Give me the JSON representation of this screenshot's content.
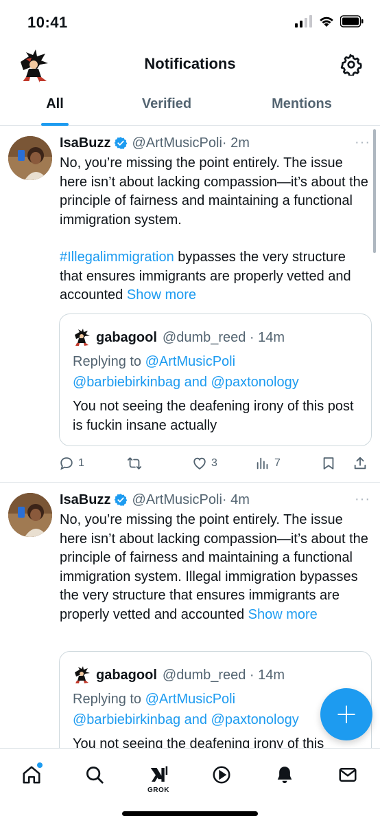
{
  "status_bar": {
    "time": "10:41"
  },
  "header": {
    "title": "Notifications"
  },
  "tabs": [
    {
      "label": "All",
      "active": true
    },
    {
      "label": "Verified",
      "active": false
    },
    {
      "label": "Mentions",
      "active": false
    }
  ],
  "tweets": [
    {
      "name": "IsaBuzz",
      "handle": "@ArtMusicPoli",
      "time": "· 2m",
      "more": "···",
      "paragraph1": "No, you’re missing the point entirely. The issue here isn’t about lacking compassion—it’s about the principle of fairness and maintaining a functional immigration system.",
      "hashtag": "#Illegalimmigration",
      "paragraph2_rest": " bypasses the very structure that ensures immigrants are properly vetted and accounted ",
      "show_more": "Show more",
      "quote": {
        "name": "gabagool",
        "handle": "@dumb_reed · 14m",
        "replying_prefix": "Replying to ",
        "replying_user1": "@ArtMusicPoli",
        "replying_user2": "@barbiebirkinbag",
        "replying_and": " and ",
        "replying_user3": "@paxtonology",
        "text": "You not seeing the deafening irony of this post is fuckin insane actually"
      },
      "actions": {
        "replies": "1",
        "retweets": "",
        "likes": "3",
        "views": "7"
      }
    },
    {
      "name": "IsaBuzz",
      "handle": "@ArtMusicPoli",
      "time": "· 4m",
      "more": "···",
      "text": "No, you’re missing the point entirely. The issue here isn’t about lacking compassion—it’s about the principle of fairness and maintaining a functional immigration system. Illegal immigration bypasses the very structure that ensures immigrants are properly vetted and accounted ",
      "show_more": "Show more",
      "quote": {
        "name": "gabagool",
        "handle": "@dumb_reed · 14m",
        "replying_prefix": "Replying to ",
        "replying_user1": "@ArtMusicPoli",
        "replying_user2": "@barbiebirkinbag",
        "replying_and": " and ",
        "replying_user3": "@paxtonology",
        "text": "You not seeing the deafening irony of this"
      }
    }
  ],
  "fab": {
    "label": "+"
  },
  "bottom_nav": {
    "grok_label": "GROK"
  },
  "colors": {
    "accent": "#1d9bf0",
    "text": "#0f1419",
    "secondary": "#536471",
    "border": "#cfd9de"
  },
  "icons": [
    "gear-icon",
    "verified-badge-icon",
    "reply-icon",
    "retweet-icon",
    "like-icon",
    "views-icon",
    "bookmark-icon",
    "share-icon",
    "home-icon",
    "search-icon",
    "grok-icon",
    "play-icon",
    "bell-icon",
    "mail-icon"
  ]
}
